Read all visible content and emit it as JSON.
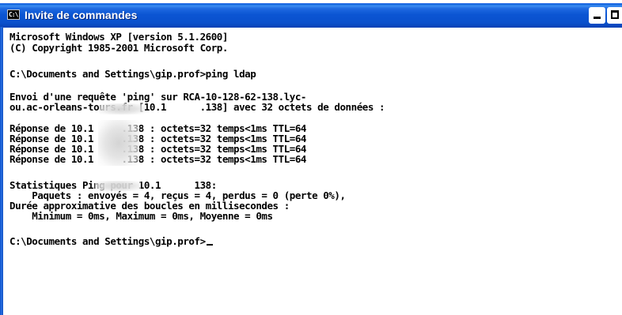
{
  "window": {
    "title": "Invite de commandes",
    "icon_label": "C:\\"
  },
  "titlebar_buttons": {
    "minimize": "minimize-icon",
    "maximize": "maximize-icon"
  },
  "console": {
    "lines": [
      "Microsoft Windows XP [version 5.1.2600]",
      "(C) Copyright 1985-2001 Microsoft Corp.",
      "",
      "C:\\Documents and Settings\\gip.prof>ping ldap",
      "",
      "Envoi d'une requête 'ping' sur RCA-10-128-62-138.lyc-",
      "ou.ac-orleans-tours.fr [10.1      .138] avec 32 octets de données :",
      "",
      "Réponse de 10.1     .138 : octets=32 temps<1ms TTL=64",
      "Réponse de 10.1     .138 : octets=32 temps<1ms TTL=64",
      "Réponse de 10.1     .138 : octets=32 temps<1ms TTL=64",
      "Réponse de 10.1     .138 : octets=32 temps<1ms TTL=64",
      "",
      "Statistiques Ping pour 10.1      138:",
      "    Paquets : envoyés = 4, reçus = 4, perdus = 0 (perte 0%),",
      "Durée approximative des boucles en millisecondes :",
      "    Minimum = 0ms, Maximum = 0ms, Moyenne = 0ms",
      "",
      "C:\\Documents and Settings\\gip.prof>"
    ]
  },
  "colors": {
    "titlebar": "#0a50cc",
    "console_background": "#ffffff",
    "console_text": "#000000"
  }
}
